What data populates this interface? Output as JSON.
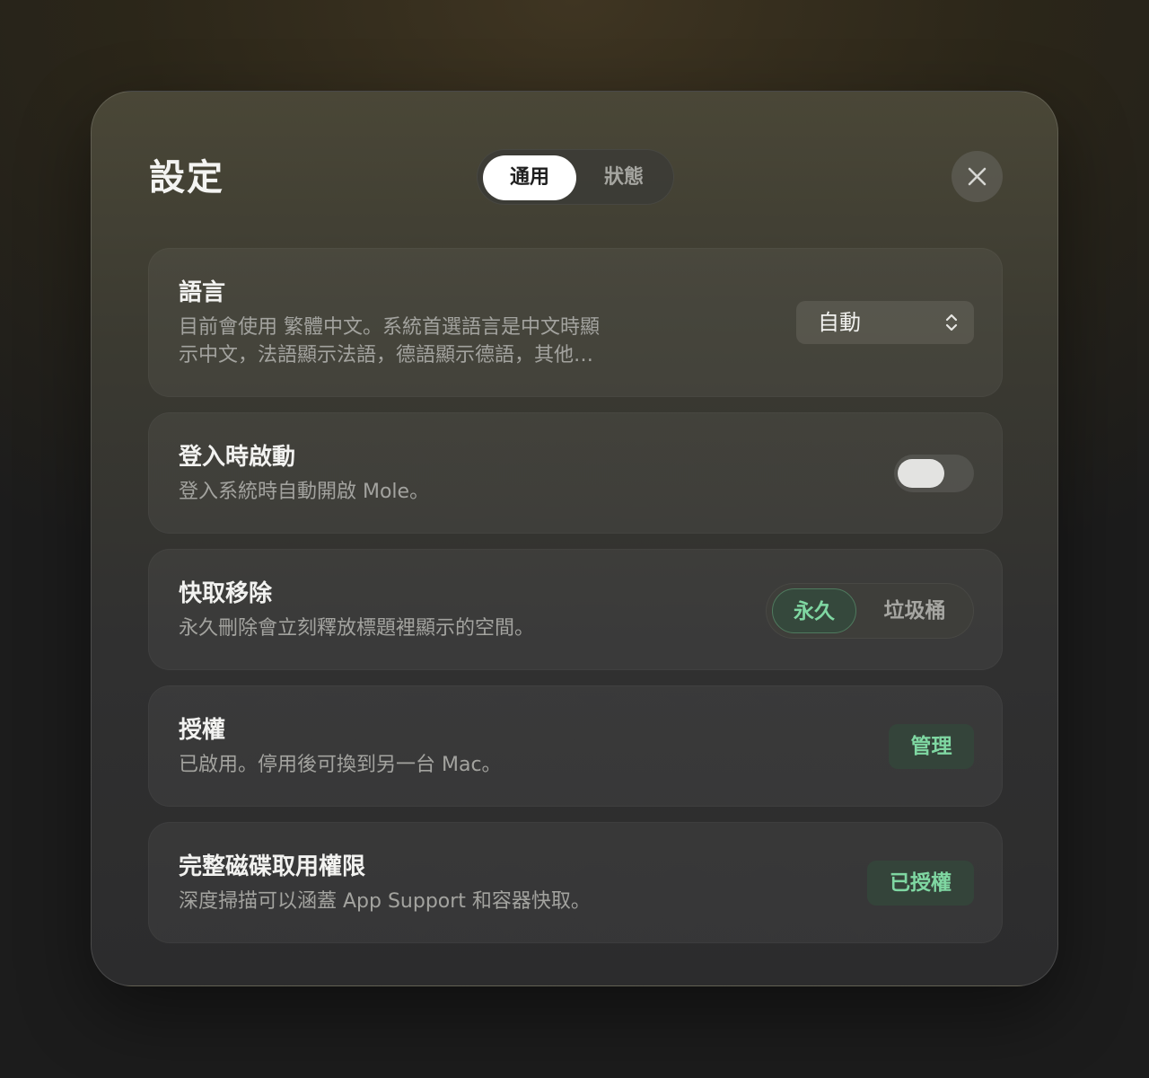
{
  "dialog": {
    "title": "設定",
    "tabs": [
      {
        "label": "通用",
        "active": true
      },
      {
        "label": "狀態",
        "active": false
      }
    ],
    "close_icon": "close-icon"
  },
  "settings": {
    "language": {
      "title": "語言",
      "description_line1": "目前會使用 繁體中文。系統首選語言是中文時顯",
      "description_line2": "示中文，法語顯示法語，德語顯示德語，其他…",
      "select_value": "自動",
      "select_icon": "chevron-up-down-icon"
    },
    "launch_at_login": {
      "title": "登入時啟動",
      "description": "登入系統時自動開啟 Mole。",
      "enabled": false
    },
    "cache_removal": {
      "title": "快取移除",
      "description": "永久刪除會立刻釋放標題裡顯示的空間。",
      "options": [
        {
          "label": "永久",
          "selected": true
        },
        {
          "label": "垃圾桶",
          "selected": false
        }
      ]
    },
    "license": {
      "title": "授權",
      "description": "已啟用。停用後可換到另一台 Mac。",
      "button_label": "管理"
    },
    "full_disk_access": {
      "title": "完整磁碟取用權限",
      "description": "深度掃描可以涵蓋 App Support 和容器快取。",
      "button_label": "已授權"
    }
  },
  "colors": {
    "accent_green": "#7fd7a2",
    "accent_green_bg": "#34443a"
  }
}
